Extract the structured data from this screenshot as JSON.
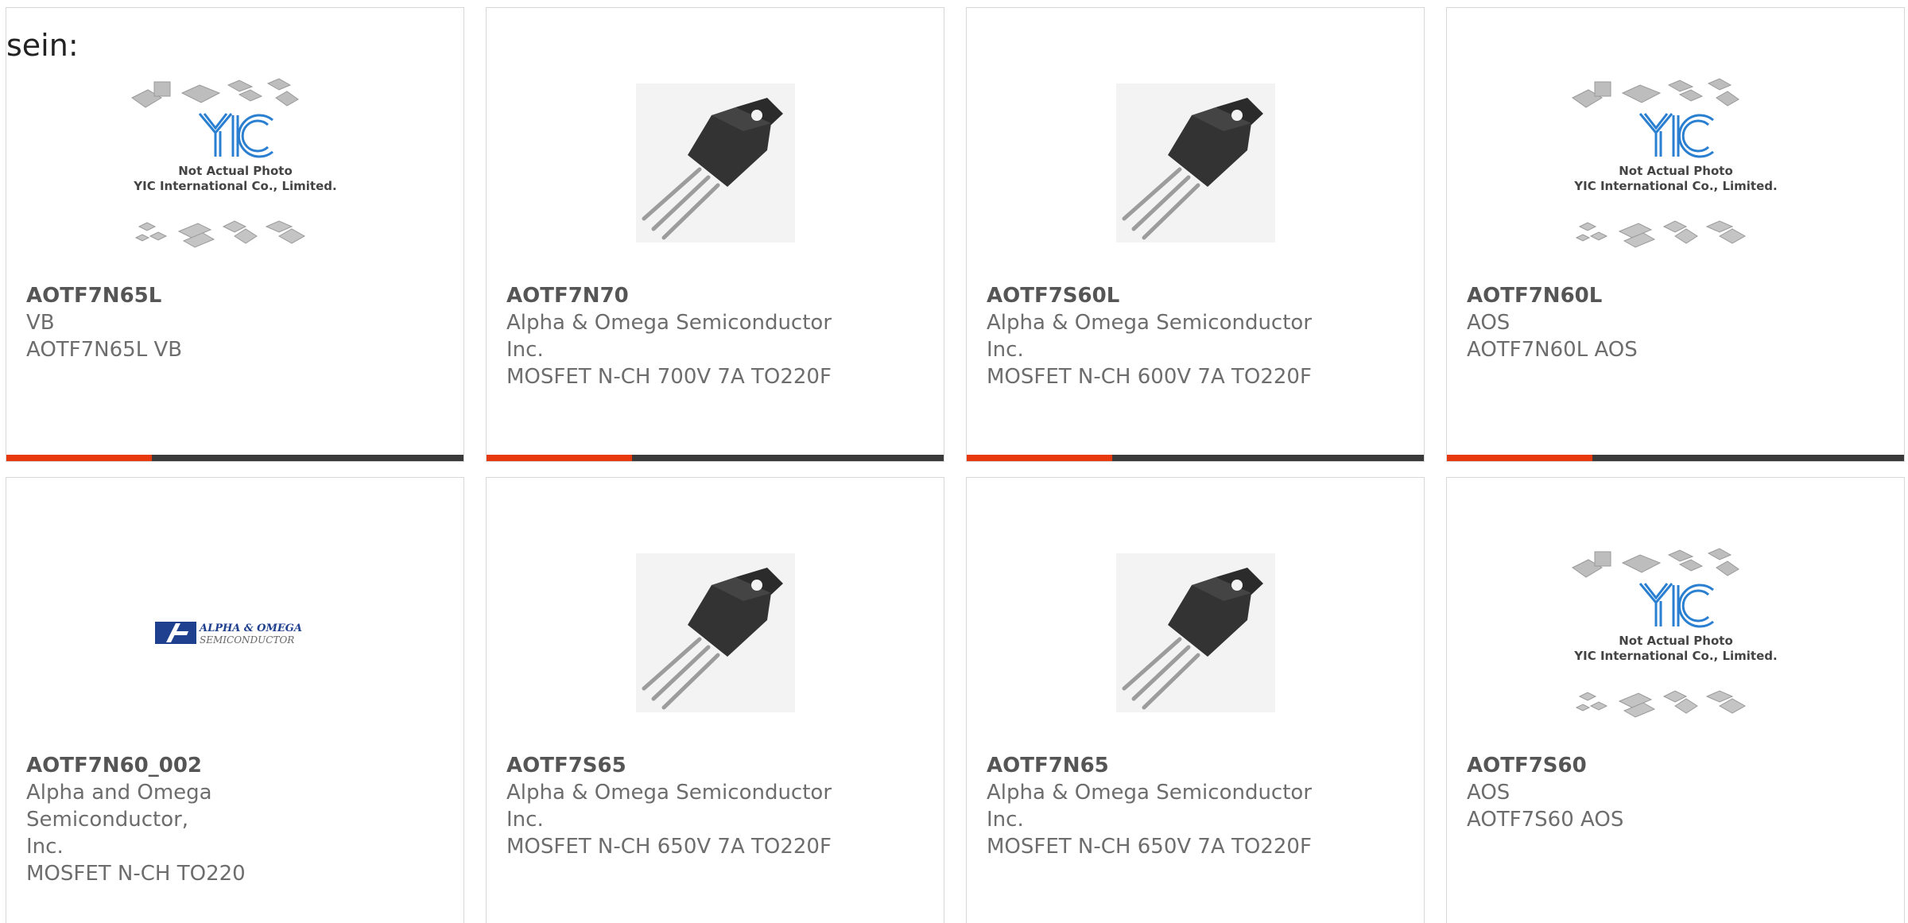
{
  "heading": "sein:",
  "placeholder_image": {
    "line1": "Not Actual Photo",
    "line2": "YIC International Co., Limited.",
    "logo": "YIC"
  },
  "aos_logo": {
    "line1": "ALPHA & OMEGA",
    "line2": "SEMICONDUCTOR"
  },
  "products": [
    {
      "part": "AOTF7N65L",
      "manufacturer_lines": [
        "VB"
      ],
      "description": "AOTF7N65L VB",
      "image": "placeholder"
    },
    {
      "part": "AOTF7N70",
      "manufacturer_lines": [
        "Alpha & Omega Semiconductor",
        "Inc."
      ],
      "description": "MOSFET N-CH 700V 7A TO220F",
      "image": "to220f"
    },
    {
      "part": "AOTF7S60L",
      "manufacturer_lines": [
        "Alpha & Omega Semiconductor",
        "Inc."
      ],
      "description": "MOSFET N-CH 600V 7A TO220F",
      "image": "to220f"
    },
    {
      "part": "AOTF7N60L",
      "manufacturer_lines": [
        "AOS"
      ],
      "description": "AOTF7N60L AOS",
      "image": "placeholder"
    },
    {
      "part": "AOTF7N60_002",
      "manufacturer_lines": [
        "Alpha and Omega Semiconductor,",
        "Inc."
      ],
      "description": "MOSFET N-CH TO220",
      "image": "aos-logo"
    },
    {
      "part": "AOTF7S65",
      "manufacturer_lines": [
        "Alpha & Omega Semiconductor",
        "Inc."
      ],
      "description": "MOSFET N-CH 650V 7A TO220F",
      "image": "to220f"
    },
    {
      "part": "AOTF7N65",
      "manufacturer_lines": [
        "Alpha & Omega Semiconductor",
        "Inc."
      ],
      "description": "MOSFET N-CH 650V 7A TO220F",
      "image": "to220f"
    },
    {
      "part": "AOTF7S60",
      "manufacturer_lines": [
        "AOS"
      ],
      "description": "AOTF7S60 AOS",
      "image": "placeholder"
    }
  ],
  "colors": {
    "accent_bar": "#e8380d",
    "bar": "#3a3a3a",
    "logo_blue": "#2a7fd0"
  }
}
